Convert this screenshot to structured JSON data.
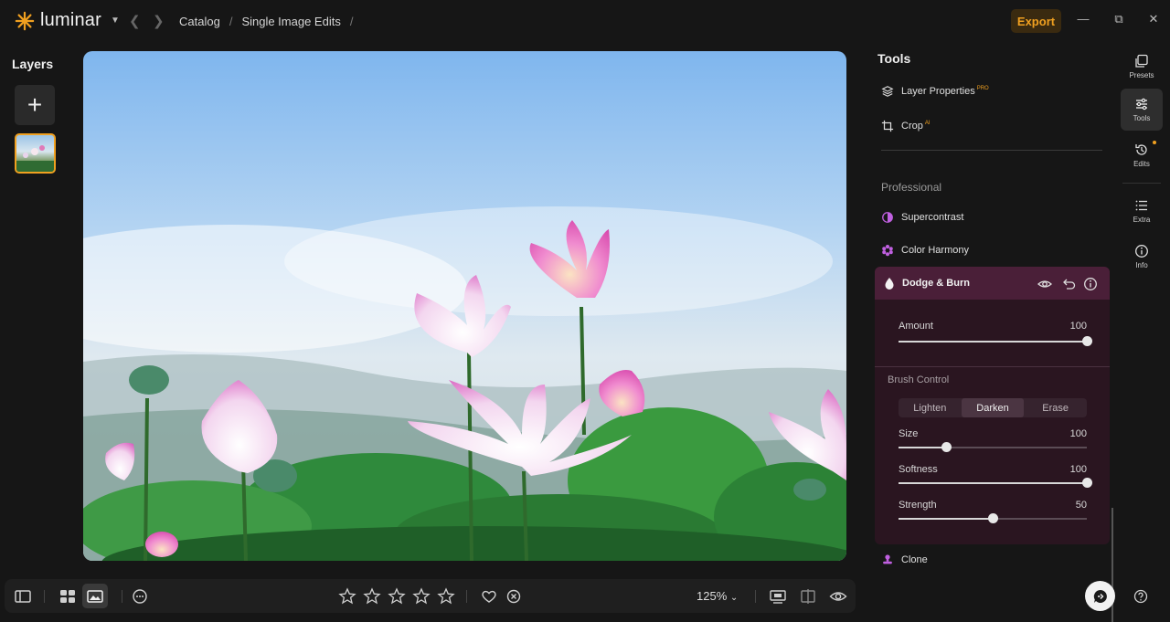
{
  "app": {
    "name": "luminar"
  },
  "breadcrumb": {
    "items": [
      "Catalog",
      "Single Image Edits"
    ]
  },
  "header": {
    "export_label": "Export"
  },
  "layers": {
    "title": "Layers"
  },
  "bottombar": {
    "zoom": "125%",
    "rating": 0,
    "rating_max": 5
  },
  "tools": {
    "title": "Tools",
    "layer_properties": "Layer Properties",
    "layer_properties_badge": "PRO",
    "crop": "Crop",
    "crop_badge": "AI",
    "section_professional": "Professional",
    "supercontrast": "Supercontrast",
    "color_harmony": "Color Harmony",
    "clone": "Clone"
  },
  "dodge_burn": {
    "title": "Dodge & Burn",
    "amount_label": "Amount",
    "amount_value": "100",
    "amount_fraction": 1.0,
    "brush_control": "Brush Control",
    "modes": [
      "Lighten",
      "Darken",
      "Erase"
    ],
    "active_mode": "Darken",
    "size_label": "Size",
    "size_value": "100",
    "size_fraction": 0.25,
    "softness_label": "Softness",
    "softness_value": "100",
    "softness_fraction": 1.0,
    "strength_label": "Strength",
    "strength_value": "50",
    "strength_fraction": 0.5
  },
  "rail": {
    "presets": "Presets",
    "tools": "Tools",
    "edits": "Edits",
    "extra": "Extra",
    "info": "Info"
  },
  "colors": {
    "accent": "#f0a020",
    "panel": "#2a1520",
    "panel_head": "#4a1f38",
    "tool_icon": "#c060e0"
  }
}
